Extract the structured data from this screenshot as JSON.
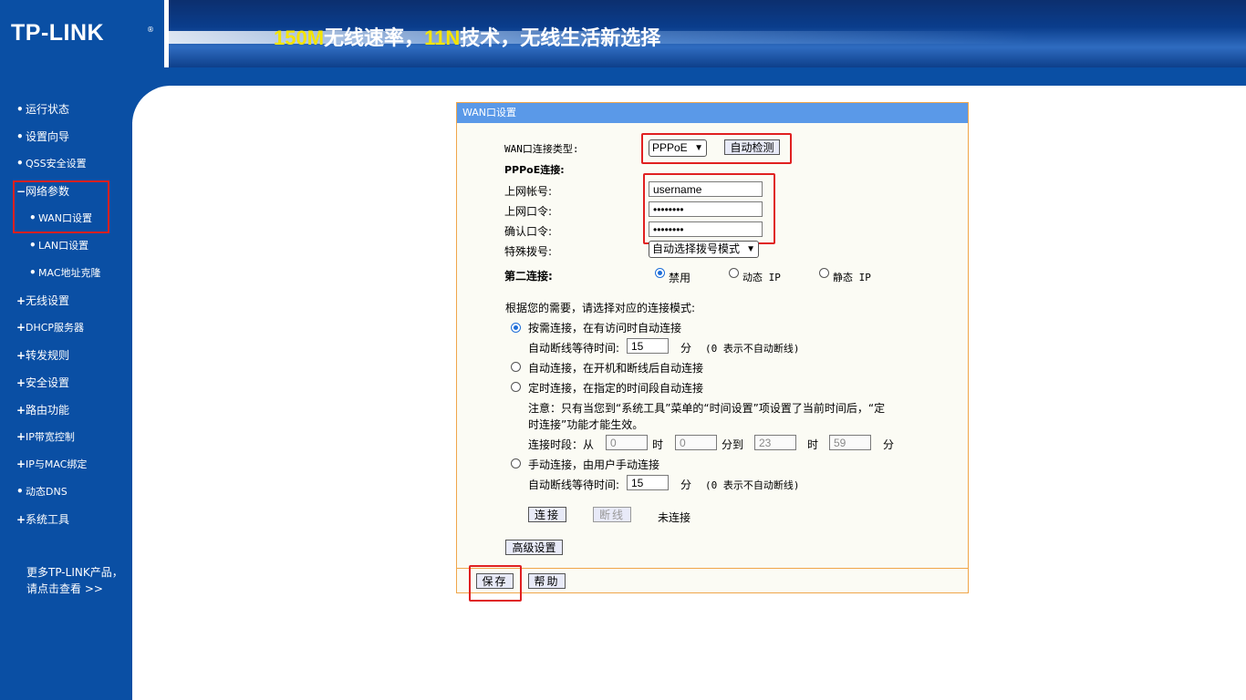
{
  "header": {
    "logo": "TP-LINK",
    "logo_reg": "®",
    "slogan_parts": [
      "150M",
      "无线速率，",
      "11N",
      "技术，无线生活新选择"
    ]
  },
  "sidebar": {
    "items": [
      {
        "label": "运行状态",
        "bullet": "•"
      },
      {
        "label": "设置向导",
        "bullet": "•"
      },
      {
        "label": "QSS安全设置",
        "bullet": "•"
      },
      {
        "label": "网络参数",
        "bullet": "−"
      },
      {
        "label": "WAN口设置",
        "bullet": "•"
      },
      {
        "label": "LAN口设置",
        "bullet": "•"
      },
      {
        "label": "MAC地址克隆",
        "bullet": "•"
      },
      {
        "label": "无线设置",
        "bullet": "+"
      },
      {
        "label": "DHCP服务器",
        "bullet": "+"
      },
      {
        "label": "转发规则",
        "bullet": "+"
      },
      {
        "label": "安全设置",
        "bullet": "+"
      },
      {
        "label": "路由功能",
        "bullet": "+"
      },
      {
        "label": "IP带宽控制",
        "bullet": "+"
      },
      {
        "label": "IP与MAC绑定",
        "bullet": "+"
      },
      {
        "label": "动态DNS",
        "bullet": "•"
      },
      {
        "label": "系统工具",
        "bullet": "+"
      }
    ],
    "more_line1": "更多TP-LINK产品，",
    "more_line2": "请点击查看 >>"
  },
  "panel": {
    "title": "WAN口设置",
    "wan_type_label": "WAN口连接类型:",
    "wan_type_value": "PPPoE",
    "auto_detect": "自动检测",
    "pppoe_header": "PPPoE连接:",
    "account_label": "上网帐号:",
    "account_value": "username",
    "password_label": "上网口令:",
    "password_value": "••••••••",
    "confirm_label": "确认口令:",
    "confirm_value": "••••••••",
    "special_dial_label": "特殊拨号:",
    "special_dial_value": "自动选择拨号模式",
    "second_conn_label": "第二连接:",
    "second_options": [
      "禁用",
      "动态 IP",
      "静态 IP"
    ],
    "second_selected": "禁用",
    "mode_prompt": "根据您的需要，请选择对应的连接模式:",
    "mode_on_demand": "按需连接，在有访问时自动连接",
    "idle_label_1": "自动断线等待时间:",
    "idle_value_1": "15",
    "idle_unit": "分",
    "idle_note": "(0 表示不自动断线)",
    "mode_auto": "自动连接，在开机和断线后自动连接",
    "mode_timed": "定时连接，在指定的时间段自动连接",
    "timed_note_1": "注意：只有当您到“系统工具”菜单的“时间设置”项设置了当前时间后，“定",
    "timed_note_2": "时连接”功能才能生效。",
    "period_label": "连接时段：从",
    "from_hour": "0",
    "hour_unit": "时",
    "from_min": "0",
    "min_to": "分到",
    "to_hour": "23",
    "to_min": "59",
    "min_unit": "分",
    "mode_manual": "手动连接，由用户手动连接",
    "idle_label_2": "自动断线等待时间:",
    "idle_value_2": "15",
    "connect_btn": "连接",
    "disconnect_btn": "断线",
    "status": "未连接",
    "advanced_btn": "高级设置",
    "save_btn": "保存",
    "help_btn": "帮助"
  },
  "colors": {
    "brand_blue": "#0a4fa4",
    "panel_title_bg": "#5a99e8",
    "panel_border": "#f0a64a",
    "annotation_red": "#e02020",
    "slogan_highlight": "#f5e400"
  }
}
